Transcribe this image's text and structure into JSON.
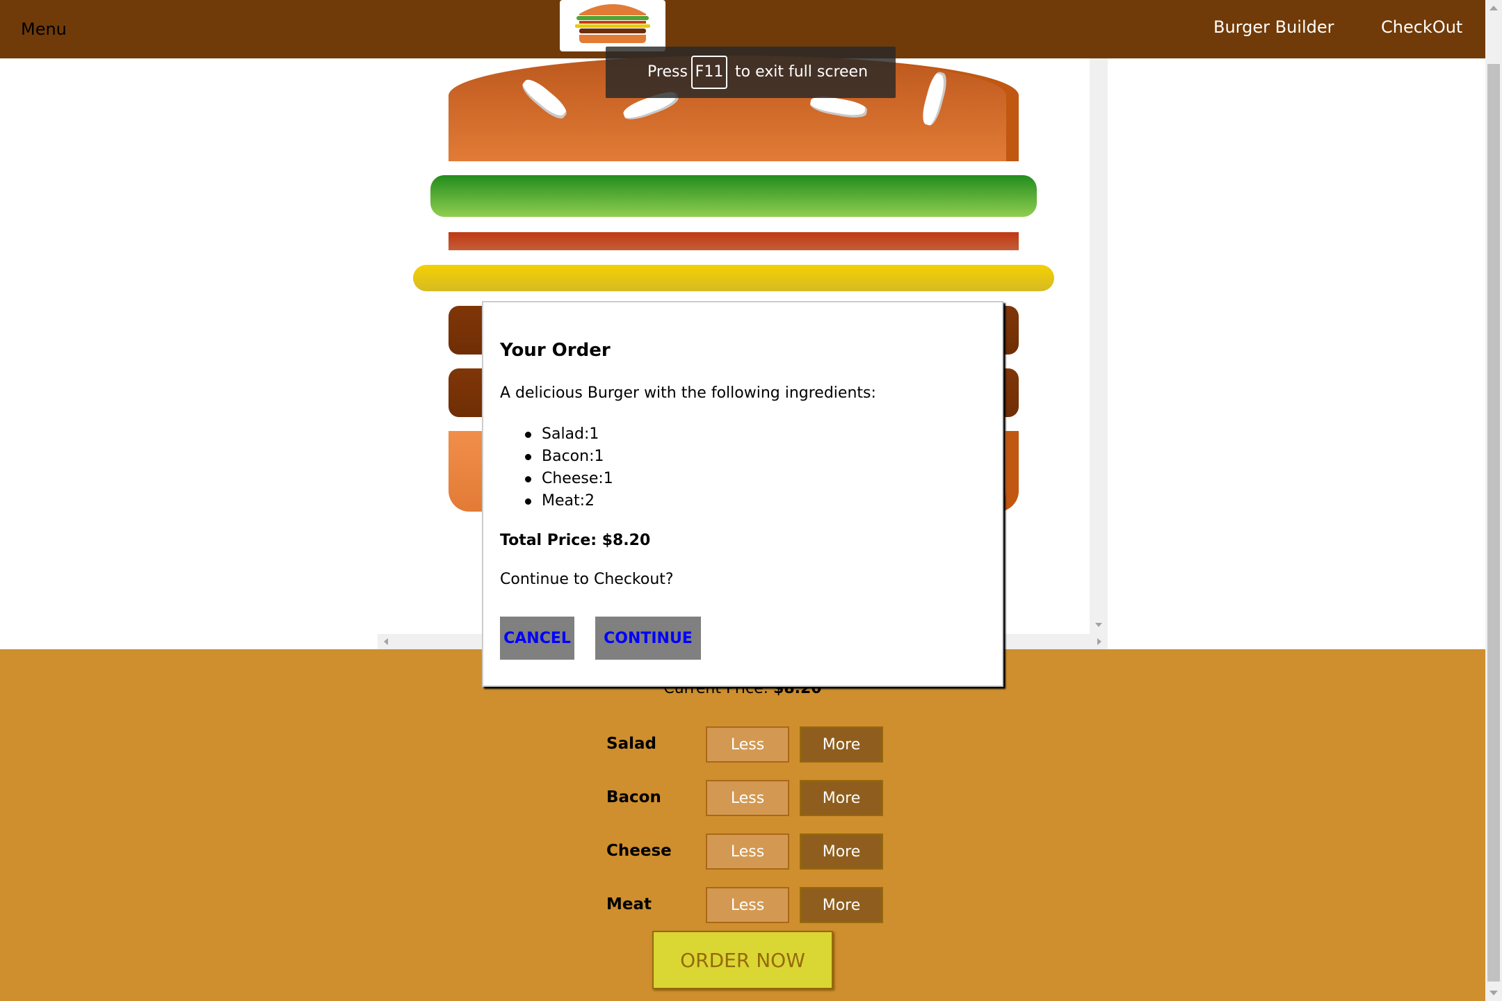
{
  "toolbar": {
    "menu_label": "Menu",
    "nav": {
      "burger_builder": "Burger Builder",
      "checkout": "CheckOut"
    }
  },
  "fullscreen_notice": {
    "prefix": "Press",
    "key": "F11",
    "suffix": "to exit full screen"
  },
  "modal": {
    "title": "Your Order",
    "description": "A delicious Burger with the following ingredients:",
    "ingredients": [
      "Salad:1",
      "Bacon:1",
      "Cheese:1",
      "Meat:2"
    ],
    "total": "Total Price: $8.20",
    "question": "Continue to Checkout?",
    "cancel_label": "CANCEL",
    "continue_label": "CONTINUE"
  },
  "build_controls": {
    "price_label": "Current Price:",
    "price_value": "$8.20",
    "rows": [
      {
        "label": "Salad",
        "less": "Less",
        "more": "More"
      },
      {
        "label": "Bacon",
        "less": "Less",
        "more": "More"
      },
      {
        "label": "Cheese",
        "less": "Less",
        "more": "More"
      },
      {
        "label": "Meat",
        "less": "Less",
        "more": "More"
      }
    ],
    "order_label": "ORDER NOW"
  },
  "colors": {
    "toolbar": "#703B09",
    "controls_bg": "#CF8F2E",
    "less_button": "#D39952",
    "more_button": "#8F5E1E",
    "order_button": "#DAD735",
    "modal_button": "#808080",
    "modal_button_text": "#0000FF"
  },
  "icons": {
    "logo": "burger-logo-icon"
  }
}
